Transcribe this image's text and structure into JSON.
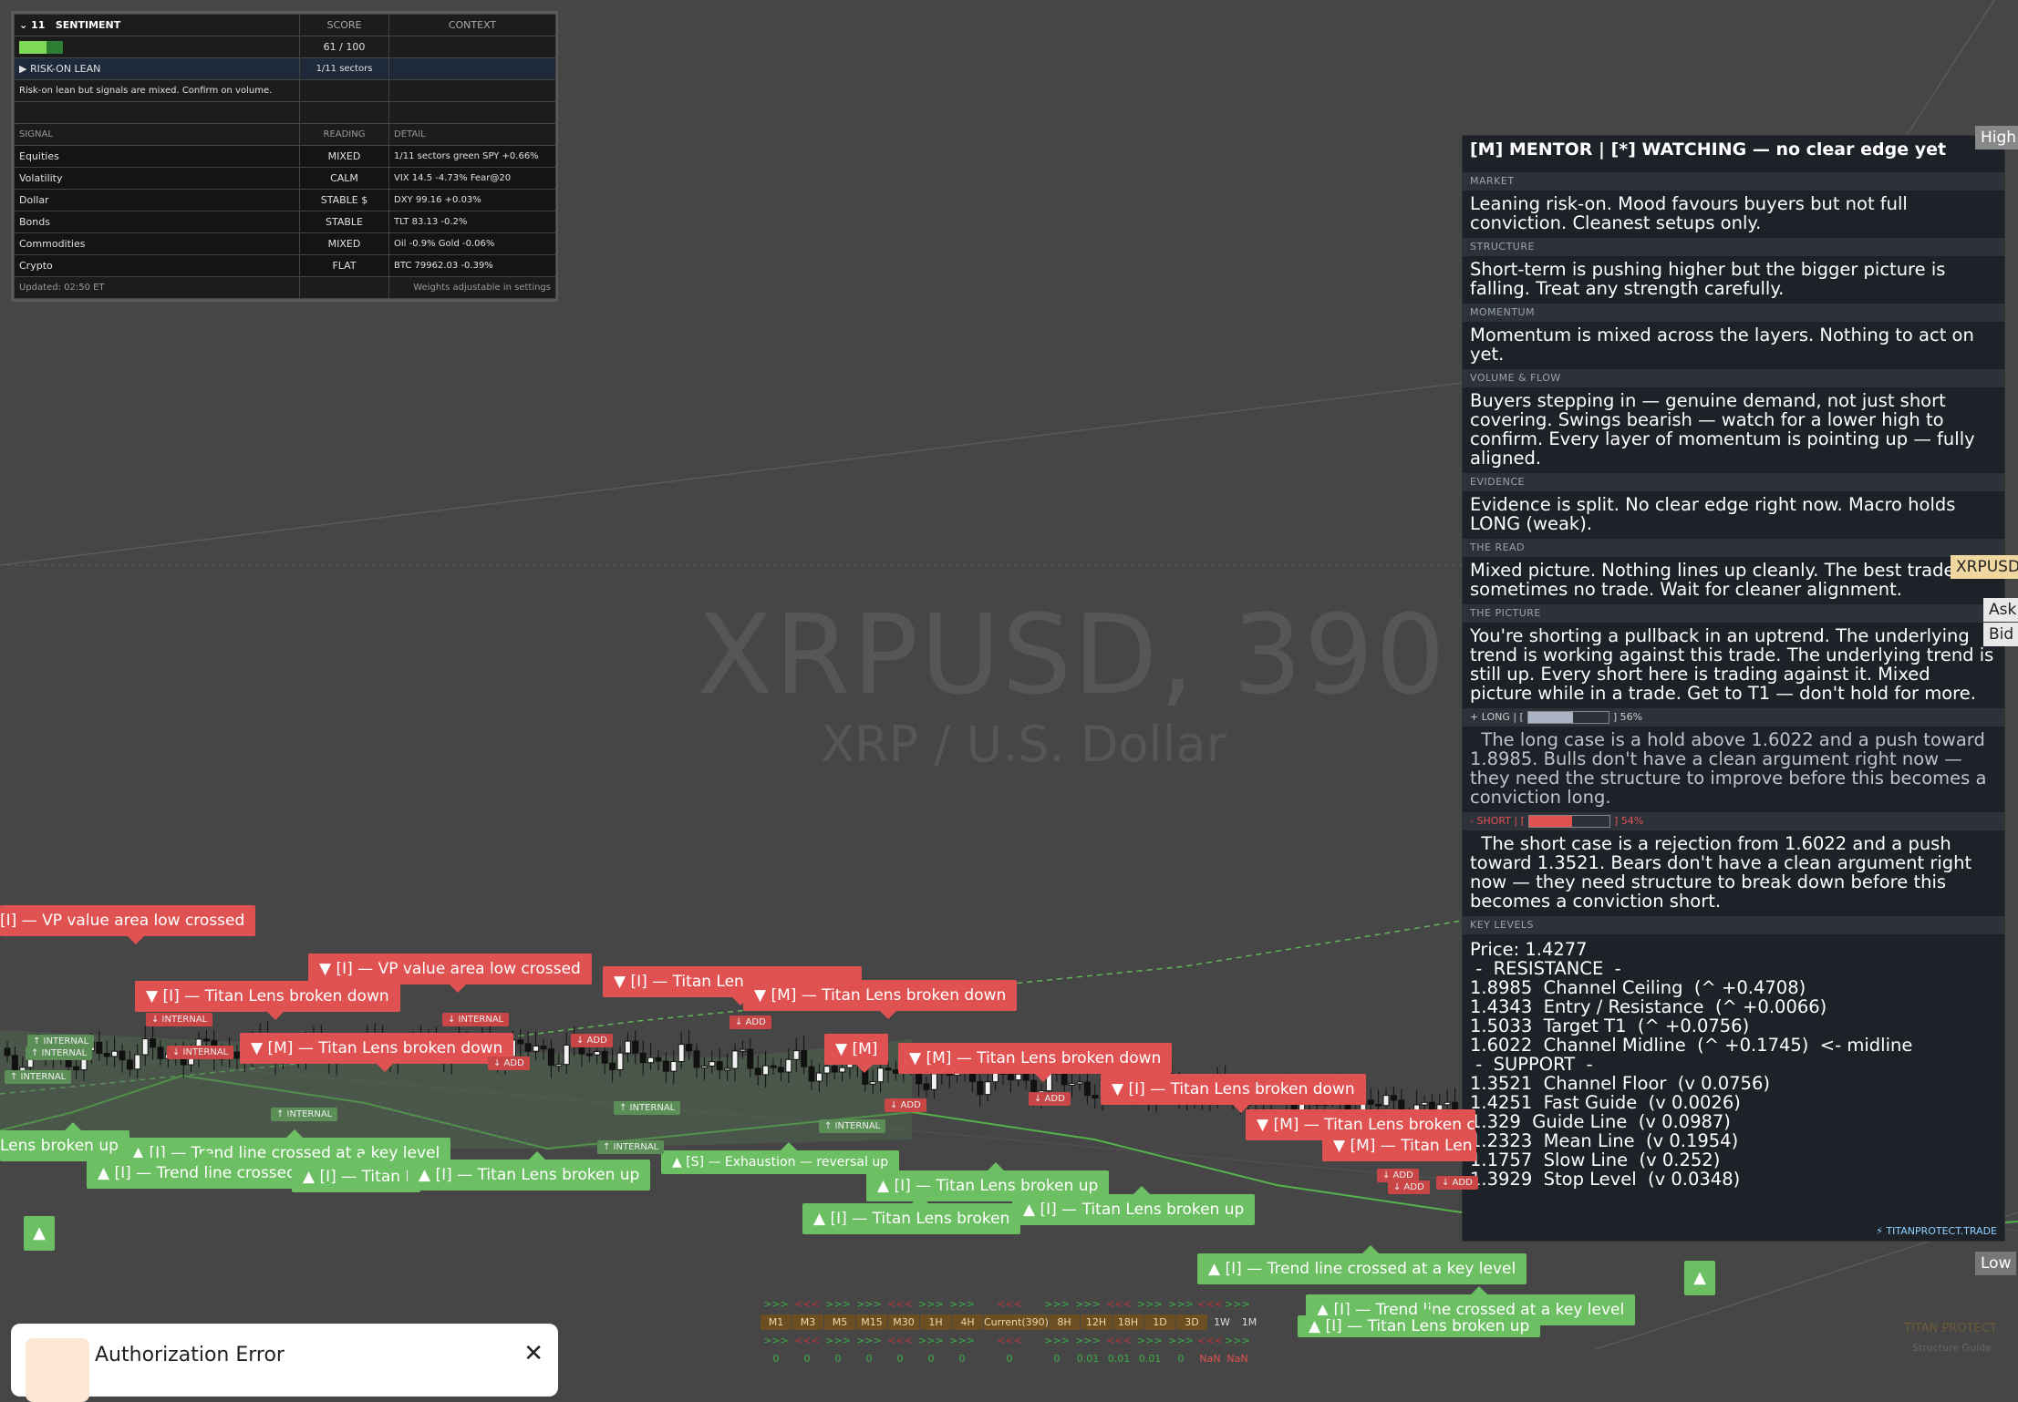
{
  "watermark": {
    "symbol": "XRPUSD, 390",
    "name": "XRP / U.S. Dollar"
  },
  "sentiment": {
    "collapse_label": "11",
    "title": "SENTIMENT",
    "col_score": "SCORE",
    "col_context": "CONTEXT",
    "score": "61 / 100",
    "score_fraction": 0.61,
    "lean": "▶ RISK-ON LEAN",
    "lean_sectors": "1/11 sectors",
    "summary": "Risk-on lean but signals are mixed. Confirm on volume.",
    "col_signal": "SIGNAL",
    "col_reading": "READING",
    "col_detail": "DETAIL",
    "rows": [
      {
        "signal": "Equities",
        "reading": "MIXED",
        "detail": "1/11 sectors green  SPY +0.66%"
      },
      {
        "signal": "Volatility",
        "reading": "CALM",
        "detail": "VIX 14.5  -4.73%  Fear@20"
      },
      {
        "signal": "Dollar",
        "reading": "STABLE $",
        "detail": "DXY 99.16  +0.03%"
      },
      {
        "signal": "Bonds",
        "reading": "STABLE",
        "detail": "TLT 83.13  -0.2%"
      },
      {
        "signal": "Commodities",
        "reading": "MIXED",
        "detail": "Oil -0.9%  Gold -0.06%"
      },
      {
        "signal": "Crypto",
        "reading": "FLAT",
        "detail": "BTC 79962.03  -0.39%"
      }
    ],
    "updated": "Updated: 02:50 ET",
    "footer": "Weights adjustable in settings",
    "colors": {
      "mixed": "#f5c542",
      "calm": "#7ed957",
      "stable": "#f5c542",
      "flat": "#f5c542"
    }
  },
  "mentor": {
    "header": "[M]  MENTOR  |  [*]  WATCHING  —  no clear edge yet",
    "sections": [
      {
        "label": "MARKET",
        "text": "Leaning risk-on. Mood favours buyers but not full conviction. Cleanest setups only."
      },
      {
        "label": "STRUCTURE",
        "text": "Short-term is pushing higher but the bigger picture is falling. Treat any strength carefully."
      },
      {
        "label": "MOMENTUM",
        "text": "Momentum is mixed across the layers. Nothing to act on yet."
      },
      {
        "label": "VOLUME & FLOW",
        "text": "Buyers stepping in — genuine demand, not just short covering. Swings bearish — watch for a lower high to confirm. Every layer of momentum is pointing up — fully aligned."
      },
      {
        "label": "EVIDENCE",
        "text": "Evidence is split. No clear edge right now. Macro holds LONG (weak)."
      },
      {
        "label": "THE READ",
        "text": "Mixed picture. Nothing lines up cleanly. The best trade is sometimes no trade. Wait for cleaner alignment."
      },
      {
        "label": "THE PICTURE",
        "text": "You're shorting a pullback in an uptrend. The underlying trend is working against this trade. The underlying trend is still up. Every short here is trading against it. Mixed picture while in a trade. Get to T1 — don't hold for more."
      }
    ],
    "long_label": "+ LONG  |  [",
    "long_pct": "] 56%",
    "long_value": 0.56,
    "long_text": "  The long case is a hold above 1.6022 and a push toward 1.8985. Bulls don't have a clean argument right now — they need the structure to improve before this becomes a conviction long.",
    "short_label": "- SHORT  |  [",
    "short_pct": "] 54%",
    "short_value": 0.54,
    "short_text": "  The short case is a rejection from 1.6022 and a push toward 1.3521. Bears don't have a clean argument right now — they need structure to break down before this becomes a conviction short.",
    "levels_label": "KEY LEVELS",
    "levels": [
      "Price: 1.4277",
      " -  RESISTANCE  -",
      "1.8985  Channel Ceiling  (^ +0.4708)",
      "1.4343  Entry / Resistance  (^ +0.0066)",
      "1.5033  Target T1  (^ +0.0756)",
      "1.6022  Channel Midline  (^ +0.1745)  <- midline",
      " -  SUPPORT  -",
      "1.3521  Channel Floor  (v 0.0756)",
      "1.4251  Fast Guide  (v 0.0026)",
      "1.329  Guide Line  (v 0.0987)",
      "1.2323  Mean Line  (v 0.1954)",
      "1.1757  Slow Line  (v 0.252)",
      "1.3929  Stop Level  (v 0.0348)"
    ],
    "footer": "⚡ TITANPROTECT.TRADE"
  },
  "price_tags": {
    "high": "High",
    "low": "Low",
    "symbol": "XRPUSD",
    "ask": "Ask",
    "bid": "Bid"
  },
  "labels_red": [
    "[I] — VP value area low crossed",
    "▼ [I] — VP value area low crossed",
    "▼ [I] — Titan Lens broken down",
    "▼ [I] — Titan Len",
    "▼ [M] — Titan Lens broken down",
    "▼ [M] — Titan Lens broken down",
    "▼ [M]",
    "▼ [M] — Titan Lens broken down",
    "▼ [I] — Titan Lens broken down",
    "▼ [M] — Titan Lens broken c",
    "▼ [M] — Titan Len"
  ],
  "labels_green": [
    "Lens broken up",
    "▲ [I] — Trend line crossed at a key level",
    "▲ [I] — Trend line crossed",
    "▲ [I] — Titan I",
    "▲ [I] — Titan Lens broken up",
    "▲ [S] — Exhaustion — reversal up",
    "▲ [I] — Titan Lens broken up",
    "▲ [I] — Titan Lens broken",
    "▲ [I] — Titan Lens broken up",
    "▲ [I] — Trend line crossed at a key level",
    "▲ [I] — Trend line crossed at a key level",
    "▲ [I] — Titan Lens broken up"
  ],
  "small_tags": {
    "internal": "↑ INTERNAL",
    "internal_down": "↓ INTERNAL",
    "add_down": "↓ ADD",
    "add_up": "↑ ADD"
  },
  "timeframes": {
    "labels": [
      "M1",
      "M3",
      "M5",
      "M15",
      "M30",
      "1H",
      "4H",
      "Current(390)",
      "8H",
      "12H",
      "18H",
      "1D",
      "3D",
      "1W",
      "1M"
    ],
    "values": [
      "0",
      "0",
      "0",
      "0",
      "0",
      "0",
      "0",
      "0",
      "0",
      "0.01",
      "0.01",
      "0.01",
      "0",
      "NaN",
      "NaN"
    ]
  },
  "brand": {
    "name": "TITAN PROTECT",
    "sub": "Structure Guide"
  },
  "toast": {
    "title": "Authorization Error",
    "close": "✕"
  }
}
